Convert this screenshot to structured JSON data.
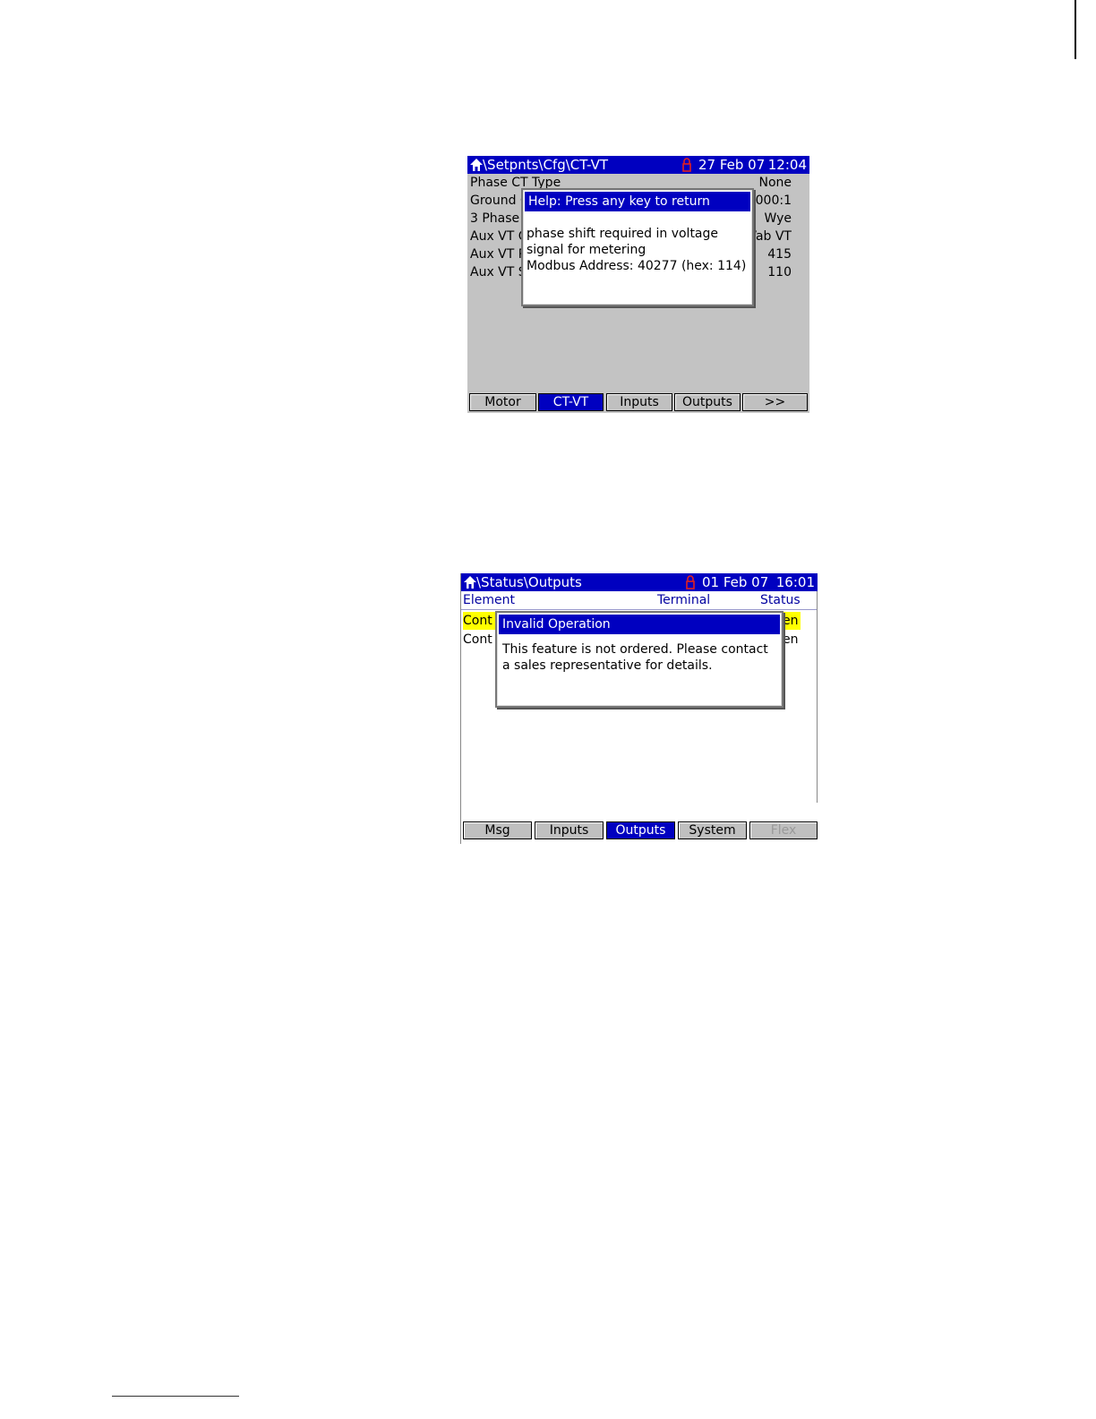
{
  "screen1": {
    "title_path": "\\Setpnts\\Cfg\\CT-VT",
    "date": "27 Feb 07",
    "time": "12:04",
    "rows": [
      {
        "label": "Phase CT Type",
        "value": "None"
      },
      {
        "label": "Ground C",
        "value": "2000:1"
      },
      {
        "label": "3 Phase",
        "value": "Wye"
      },
      {
        "label": "Aux VT C",
        "value": "Vab VT"
      },
      {
        "label": "Aux VT Pr",
        "value": "415"
      },
      {
        "label": "Aux VT Se",
        "value": "110"
      }
    ],
    "dialog": {
      "title": "Help: Press any key to return",
      "line1": "phase shift required in voltage",
      "line2": "signal for metering",
      "line3": "Modbus Address: 40277 (hex: 114)"
    },
    "tabs": [
      "Motor",
      "CT-VT",
      "Inputs",
      "Outputs",
      ">>"
    ],
    "active_tab": "CT-VT"
  },
  "screen2": {
    "title_path": "\\Status\\Outputs",
    "date": "01 Feb 07",
    "time": "16:01",
    "columns": [
      "Element",
      "Terminal",
      "Status"
    ],
    "rows": [
      {
        "element": "Cont",
        "status": "en",
        "highlighted": true
      },
      {
        "element": "Cont",
        "status": "en",
        "highlighted": false
      }
    ],
    "dialog": {
      "title": "Invalid Operation",
      "line1": "This feature is not ordered.  Please contact",
      "line2": "a sales representative for details."
    },
    "tabs": [
      "Msg",
      "Inputs",
      "Outputs",
      "System",
      "Flex"
    ],
    "active_tab": "Outputs",
    "disabled_tab": "Flex"
  },
  "colors": {
    "titlebar": "#0000c0",
    "panel_gray": "#c3c3c3",
    "highlight": "#ffff00",
    "lock_icon": "#e02020"
  }
}
